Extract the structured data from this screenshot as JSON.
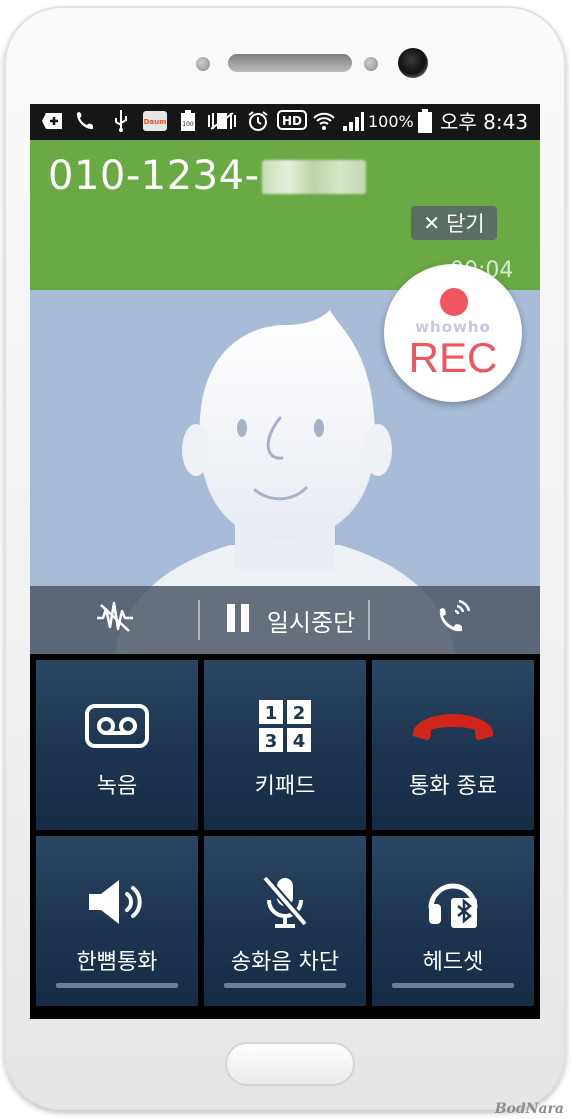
{
  "status_bar": {
    "battery": "100%",
    "time": "오후 8:43",
    "icons": [
      "add-icon",
      "call-icon",
      "usb-icon",
      "daum-icon",
      "battery-saver-icon",
      "vibrate-off-icon",
      "alarm-icon",
      "hd-icon",
      "wifi-icon",
      "signal-icon",
      "battery-icon"
    ]
  },
  "call": {
    "number": "010-1234-",
    "close_label": "닫기",
    "elapsed": "00:04"
  },
  "recorder": {
    "brand": "whowho",
    "label": "REC",
    "accent_color": "#f0545e"
  },
  "controls": {
    "pause_label": "일시중단",
    "left_icon": "noise-reduction-off-icon",
    "right_icon": "call-volume-icon"
  },
  "actions": [
    {
      "label": "녹음",
      "icon": "record-tape-icon"
    },
    {
      "label": "키패드",
      "icon": "keypad-icon"
    },
    {
      "label": "통화 종료",
      "icon": "end-call-icon"
    },
    {
      "label": "한뼘통화",
      "icon": "speaker-icon"
    },
    {
      "label": "송화음 차단",
      "icon": "mute-mic-icon"
    },
    {
      "label": "헤드셋",
      "icon": "bluetooth-headset-icon"
    }
  ],
  "keypad_digits": [
    "1",
    "2",
    "3",
    "4"
  ],
  "colors": {
    "header_green": "#6aaa45",
    "photo_bg": "#a8bcd8",
    "end_call_red": "#d0261a",
    "tile_blue": "#1d3450"
  },
  "watermark": "BodNara"
}
